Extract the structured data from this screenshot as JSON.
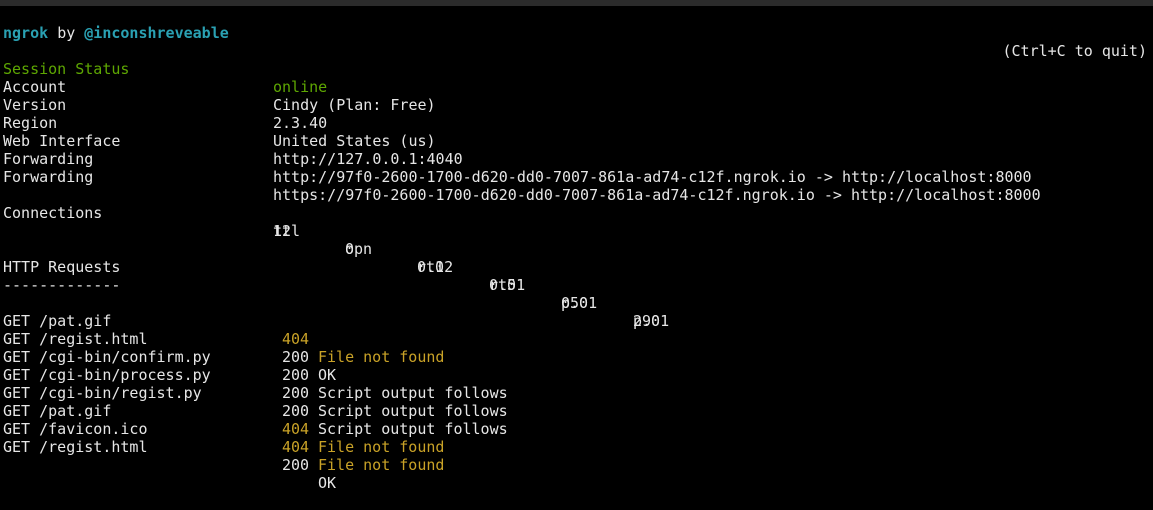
{
  "header": {
    "app": "ngrok",
    "by": "by",
    "author": "@inconshreveable",
    "quit_hint": "(Ctrl+C to quit)"
  },
  "session": [
    {
      "label": "Session Status",
      "value": "online"
    },
    {
      "label": "Account",
      "value": "Cindy (Plan: Free)"
    },
    {
      "label": "Version",
      "value": "2.3.40"
    },
    {
      "label": "Region",
      "value": "United States (us)"
    },
    {
      "label": "Web Interface",
      "value": "http://127.0.0.1:4040"
    },
    {
      "label": "Forwarding",
      "value": "http://97f0-2600-1700-d620-dd0-7007-861a-ad74-c12f.ngrok.io -> http://localhost:8000"
    },
    {
      "label": "Forwarding",
      "value": "https://97f0-2600-1700-d620-dd0-7007-861a-ad74-c12f.ngrok.io -> http://localhost:8000"
    }
  ],
  "connections": {
    "label": "Connections",
    "headers": [
      "ttl",
      "opn",
      "rt1",
      "rt5",
      "p50",
      "p90"
    ],
    "values": [
      "12",
      "0",
      "0.02",
      "0.01",
      "0.01",
      "2.01"
    ]
  },
  "http_requests": {
    "title": "HTTP Requests",
    "separator": "-------------",
    "rows": [
      {
        "request": "GET /pat.gif",
        "code": "404",
        "status": "File not found"
      },
      {
        "request": "GET /regist.html",
        "code": "200",
        "status": "OK"
      },
      {
        "request": "GET /cgi-bin/confirm.py",
        "code": "200",
        "status": "Script output follows"
      },
      {
        "request": "GET /cgi-bin/process.py",
        "code": "200",
        "status": "Script output follows"
      },
      {
        "request": "GET /cgi-bin/regist.py",
        "code": "200",
        "status": "Script output follows"
      },
      {
        "request": "GET /pat.gif",
        "code": "404",
        "status": "File not found"
      },
      {
        "request": "GET /favicon.ico",
        "code": "404",
        "status": "File not found"
      },
      {
        "request": "GET /regist.html",
        "code": "200",
        "status": "OK"
      }
    ]
  },
  "colors": {
    "background": "#000000",
    "text": "#e6e6e6",
    "teal": "#2aa1b3",
    "online": "#5ea702",
    "not_found": "#c9a227"
  }
}
